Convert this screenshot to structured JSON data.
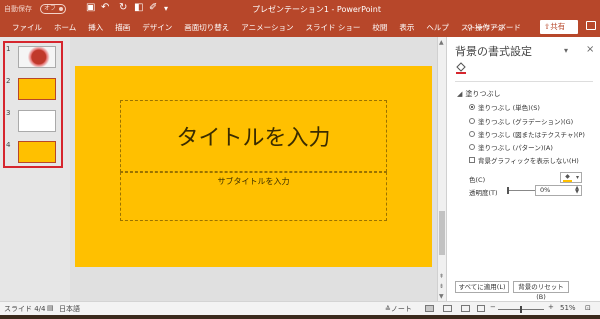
{
  "titlebar": {
    "autosave_label": "自動保存",
    "autosave_state": "オフ",
    "title": "プレゼンテーション1 - PowerPoint"
  },
  "ribbon": {
    "tabs": [
      "ファイル",
      "ホーム",
      "挿入",
      "描画",
      "デザイン",
      "画面切り替え",
      "アニメーション",
      "スライド ショー",
      "校閲",
      "表示",
      "ヘルプ",
      "ストーリーボード"
    ],
    "tell_me": "操作アシ",
    "share": "共有"
  },
  "thumbnails": [
    {
      "number": "1",
      "style": "photo"
    },
    {
      "number": "2",
      "style": "orange"
    },
    {
      "number": "3",
      "style": "white"
    },
    {
      "number": "4",
      "style": "orange"
    }
  ],
  "slide": {
    "background_color": "#ffc000",
    "title_placeholder": "タイトルを入力",
    "subtitle_placeholder": "サブタイトルを入力"
  },
  "format_pane": {
    "title": "背景の書式設定",
    "section": "塗りつぶし",
    "options": [
      {
        "label": "塗りつぶし (単色)(S)",
        "selected": true
      },
      {
        "label": "塗りつぶし (グラデーション)(G)",
        "selected": false
      },
      {
        "label": "塗りつぶし (図またはテクスチャ)(P)",
        "selected": false
      },
      {
        "label": "塗りつぶし (パターン)(A)",
        "selected": false
      }
    ],
    "hide_graphics": "背景グラフィックを表示しない(H)",
    "color_label": "色(C)",
    "transparency_label": "透明度(T)",
    "transparency_value": "0%",
    "apply_all": "すべてに適用(L)",
    "reset": "背景のリセット(B)"
  },
  "statusbar": {
    "slide_info": "スライド 4/4",
    "language": "日本語",
    "notes": "ノート",
    "zoom": "51%",
    "zoom_fraction": 0.51
  }
}
